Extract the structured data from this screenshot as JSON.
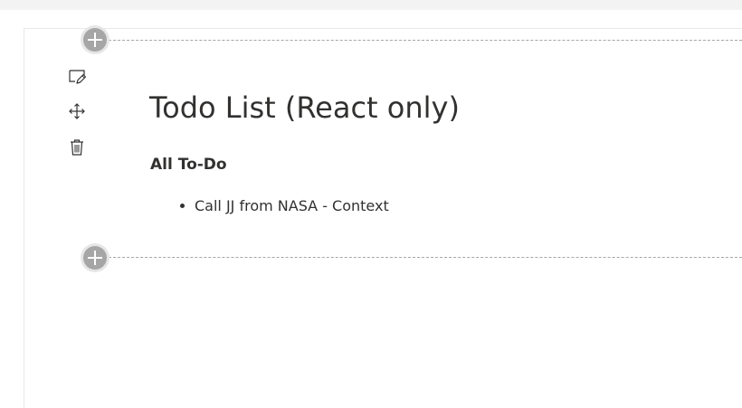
{
  "page": {
    "title": "Todo List (React only)",
    "subtitle": "All To-Do"
  },
  "todos": [
    {
      "text": "Call JJ from NASA - Context"
    }
  ],
  "toolbar": {
    "edit_icon": "edit-properties-icon",
    "move_icon": "move-icon",
    "delete_icon": "delete-icon"
  },
  "colors": {
    "add_button": "#a6a6a6",
    "text": "#323130",
    "divider": "#a6a6a6"
  }
}
